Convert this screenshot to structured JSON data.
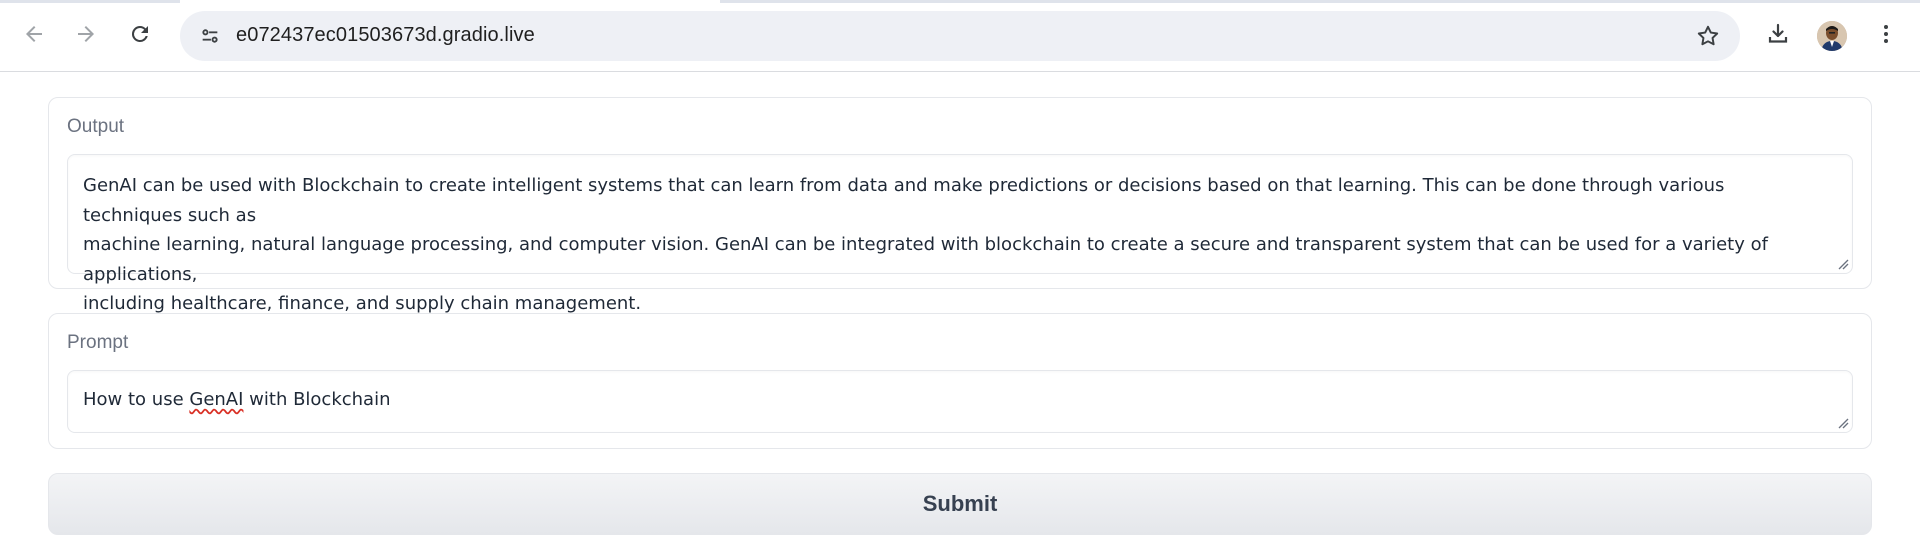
{
  "browser": {
    "url": "e072437ec01503673d.gradio.live",
    "icons": {
      "back": "back-arrow-icon",
      "forward": "forward-arrow-icon",
      "reload": "reload-icon",
      "site_info": "site-settings-icon",
      "bookmark": "star-icon",
      "download": "download-icon",
      "profile": "avatar",
      "menu": "kebab-menu-icon"
    }
  },
  "output": {
    "label": "Output",
    "value_line1": "GenAI can be used with Blockchain to create intelligent systems that can learn from data and make predictions or decisions based on that learning. This can be done through various techniques such as",
    "value_line2": "machine learning, natural language processing, and computer vision. GenAI can be integrated with blockchain to create a secure and transparent system that can be used for a variety of applications,",
    "value_line3": "including healthcare, finance, and supply chain management."
  },
  "prompt": {
    "label": "Prompt",
    "value_before": "How to use ",
    "value_misspelled": "GenAI",
    "value_after": " with Blockchain"
  },
  "submit": {
    "label": "Submit"
  },
  "colors": {
    "accent_text": "#374151",
    "label_text": "#6b7280",
    "omnibox_bg": "#eef0f5",
    "spell_error": "#d93025"
  }
}
